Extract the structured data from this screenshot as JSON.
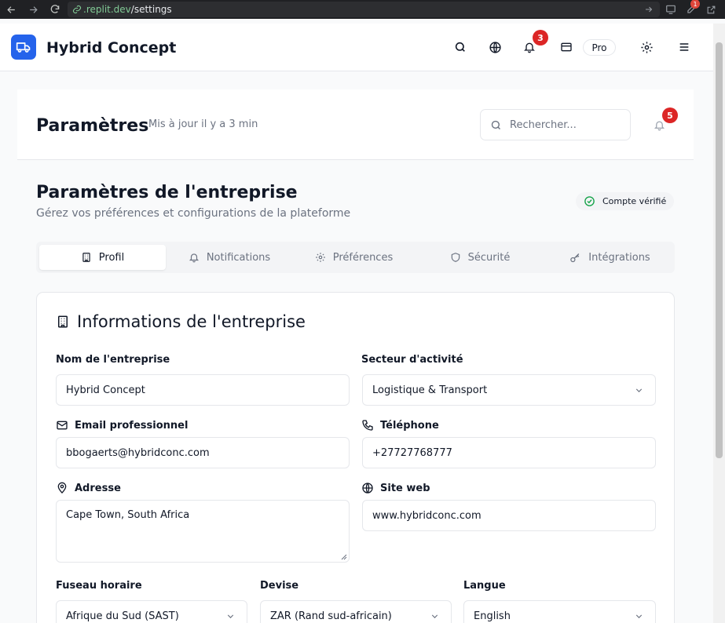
{
  "browser": {
    "url_domain": ".replit.dev",
    "url_path": "/settings",
    "ext_badge": "1"
  },
  "header": {
    "brand": "Hybrid Concept",
    "notif_count": "3",
    "plan": "Pro"
  },
  "page": {
    "title": "Paramètres",
    "updated": "Mis à jour il y a 3 min",
    "search_placeholder": "Rechercher...",
    "bell_count": "5"
  },
  "section": {
    "title": "Paramètres de l'entreprise",
    "subtitle": "Gérez vos préférences et configurations de la plateforme",
    "verified": "Compte vérifié"
  },
  "tabs": [
    {
      "label": "Profil",
      "active": true
    },
    {
      "label": "Notifications"
    },
    {
      "label": "Préférences"
    },
    {
      "label": "Sécurité"
    },
    {
      "label": "Intégrations"
    }
  ],
  "card": {
    "title": "Informations de l'entreprise",
    "company_name": {
      "label": "Nom de l'entreprise",
      "value": "Hybrid Concept"
    },
    "sector": {
      "label": "Secteur d'activité",
      "value": "Logistique & Transport"
    },
    "email": {
      "label": "Email professionnel",
      "value": "bbogaerts@hybridconc.com"
    },
    "phone": {
      "label": "Téléphone",
      "value": "+27727768777"
    },
    "address": {
      "label": "Adresse",
      "value": "Cape Town, South Africa"
    },
    "website": {
      "label": "Site web",
      "value": "www.hybridconc.com"
    },
    "timezone": {
      "label": "Fuseau horaire",
      "value": "Afrique du Sud (SAST)"
    },
    "currency": {
      "label": "Devise",
      "value": "ZAR (Rand sud-africain)"
    },
    "language": {
      "label": "Langue",
      "value": "English"
    }
  },
  "colors": {
    "brand_blue": "#2563eb",
    "badge_red": "#dc2626",
    "verified_green": "#16a34a"
  }
}
